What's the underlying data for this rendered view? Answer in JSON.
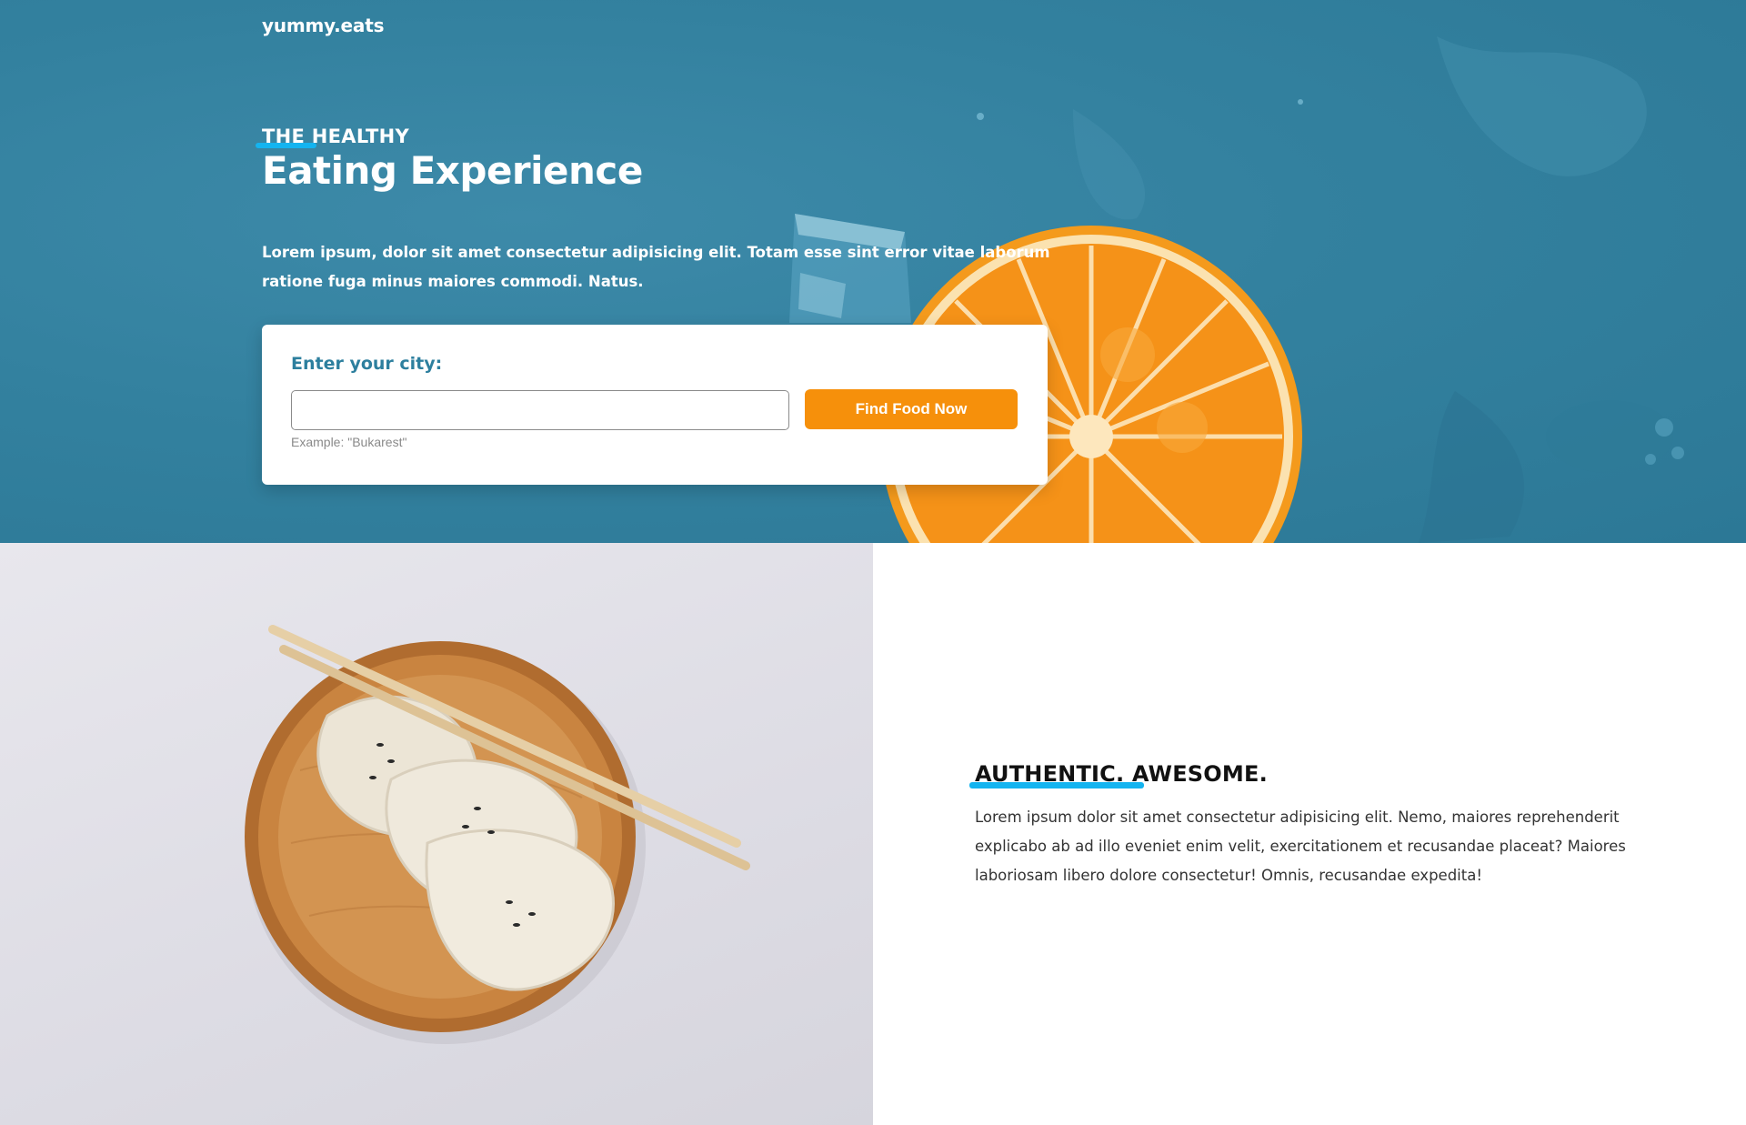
{
  "brand": {
    "name": "yummy.eats"
  },
  "hero": {
    "eyebrow": "THE HEALTHY",
    "headline": "Eating Experience",
    "intro": "Lorem ipsum, dolor sit amet consectetur adipisicing elit. Totam esse sint error vitae laborum ratione fuga minus maiores commodi. Natus."
  },
  "search": {
    "label": "Enter your city:",
    "value": "",
    "hint": "Example: \"Bukarest\"",
    "button_label": "Find Food Now"
  },
  "feature": {
    "title": "AUTHENTIC. AWESOME.",
    "body": "Lorem ipsum dolor sit amet consectetur adipisicing elit. Nemo, maiores reprehenderit explicabo ab ad illo eveniet enim velit, exercitationem et recusandae placeat? Maiores laboriosam libero dolore consectetur! Omnis, recusandae expedita!"
  },
  "colors": {
    "hero_background": "#33819f",
    "accent_underline": "#14b4f0",
    "button": "#f6900b",
    "label": "#2d7f9e"
  },
  "icons": {
    "hero_image": "orange-slice-and-ice-image",
    "feature_image": "dumplings-plate-image"
  }
}
